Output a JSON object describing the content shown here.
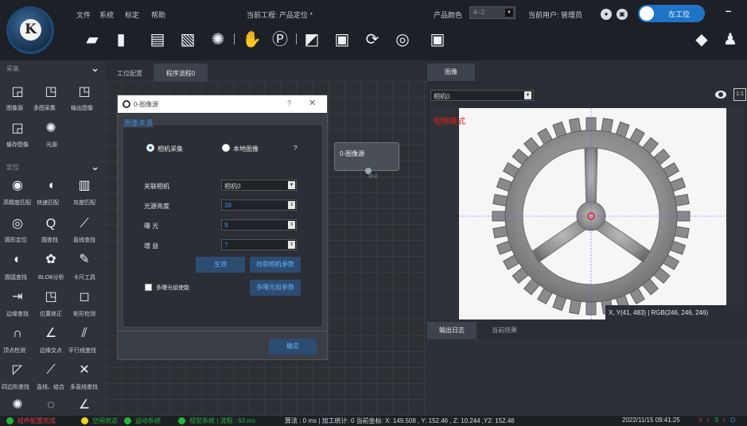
{
  "menu": {
    "file": "文件",
    "system": "系统",
    "calibrate": "标定",
    "help": "帮助"
  },
  "project": "当前工程: 产品定位 *",
  "product_color": {
    "label": "产品颜色",
    "value": "4--2"
  },
  "current_user": "当前用户: 管理员",
  "station_toggle": "左工位",
  "logo_letter": "K",
  "left_panel": {
    "sections": [
      {
        "title": "采集",
        "items": [
          "图像源",
          "多图采集",
          "输出图像",
          "缓存图像",
          "光源"
        ]
      },
      {
        "title": "定位",
        "items": [
          "高精度匹配",
          "快速匹配",
          "灰度匹配",
          "圆形定位",
          "圆查找",
          "直线查找",
          "圆弧查找",
          "BLOB分析",
          "卡尺工具",
          "边缘查找",
          "位置修正",
          "矩形检测",
          "顶点检测",
          "边缘交点",
          "平行线查找",
          "四边形查找",
          "直线、组合",
          "多直线查找"
        ]
      }
    ]
  },
  "tabs": {
    "station_config": "工位配置",
    "program_flow": "程序流程0"
  },
  "node": {
    "label": "0-图像源",
    "output": "输出"
  },
  "dialog": {
    "title": "0-图像源",
    "help": "?",
    "close": "✕",
    "group_title": "图像来源",
    "radio_camera": "相机采集",
    "radio_local": "本地图像",
    "radio_help": "?",
    "fields": {
      "camera": {
        "label": "关联相机",
        "value": "相机0"
      },
      "brightness": {
        "label": "光源亮度",
        "value": "38"
      },
      "exposure": {
        "label": "曝 光",
        "value": "9"
      },
      "gain": {
        "label": "增 益",
        "value": "7"
      }
    },
    "apply_button": "生效",
    "fetch_params_button": "拾取相机参数",
    "multi_exposure_checkbox": "多曝光组使能",
    "multi_exposure_button": "多曝光组参数",
    "confirm_button": "确定"
  },
  "image_panel": {
    "tab": "图像",
    "camera_select": "相机0",
    "fit_label": "1:1",
    "video_mode": "视频模式",
    "coords": "X, Y(41, 483) | RGB(246, 246, 246)"
  },
  "log_panel": {
    "tab_log": "输出日志",
    "tab_result": "当前结果"
  },
  "status": {
    "config_done": "组件配置完成",
    "idle": "空闲状态",
    "motion": "运动系统",
    "vision": "视觉系统 | 流程 : 63 ms",
    "measure": "算法 : 0 ms | 加工统计: 0  当前坐标: X: 149.508 , Y: 152.46 , Z: 10.244 ,Y2: 152.46",
    "datetime": "2022/11/15 09:41:25",
    "flags": [
      "V",
      "I",
      "S",
      "I",
      "O"
    ],
    "colors": {
      "green": "#27b33a",
      "yellow": "#f2d21a",
      "red": "#e23b3b",
      "blue": "#3a8fe8"
    }
  }
}
